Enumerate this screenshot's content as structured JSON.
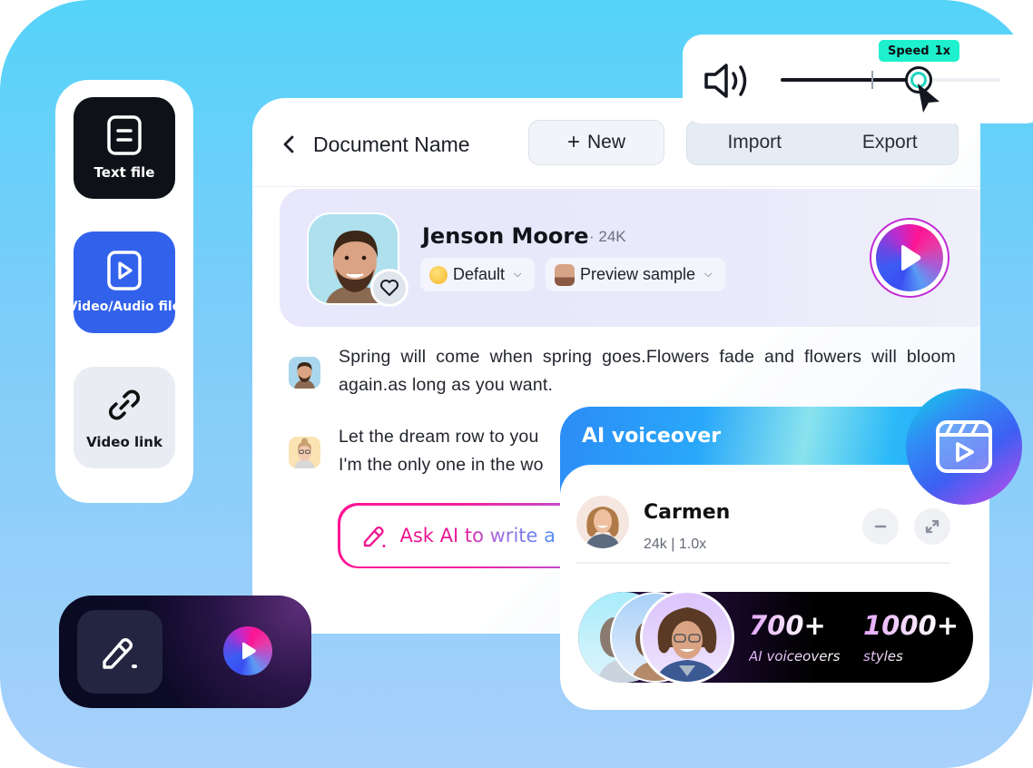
{
  "source_panel": {
    "items": [
      {
        "label": "Text file",
        "icon": "text-file-icon"
      },
      {
        "label": "Video/Audio file",
        "icon": "video-file-icon"
      },
      {
        "label": "Video link",
        "icon": "link-icon"
      }
    ]
  },
  "speed_control": {
    "badge_label": "Speed",
    "badge_value": "1x",
    "slider_value_percent": 63,
    "icon": "volume-icon"
  },
  "document": {
    "title": "Document Name",
    "new_label": "New",
    "import_label": "Import",
    "export_label": "Export"
  },
  "voice": {
    "name": "Jenson Moore",
    "count": "· 24K",
    "style_label": "Default",
    "preview_label": "Preview sample"
  },
  "paragraphs": [
    "Spring will come when spring goes.Flowers fade and flowers will bloom again.as long as you want.",
    "Let the dream row to you\nI'm the only one in the wo"
  ],
  "ask_ai": {
    "label": "Ask AI to write a"
  },
  "ai_voiceover": {
    "title": "AI voiceover",
    "speaker_name": "Carmen",
    "speaker_meta": "24k | 1.0x",
    "stats": [
      {
        "value": "700+",
        "label": "AI voiceovers"
      },
      {
        "value": "1000+",
        "label": "styles"
      }
    ]
  },
  "colors": {
    "accent_blue": "#3262ec",
    "speed_badge": "#1ef0cd",
    "ask_ai_pink": "#ff1493",
    "text_dark": "#1a1d26"
  }
}
